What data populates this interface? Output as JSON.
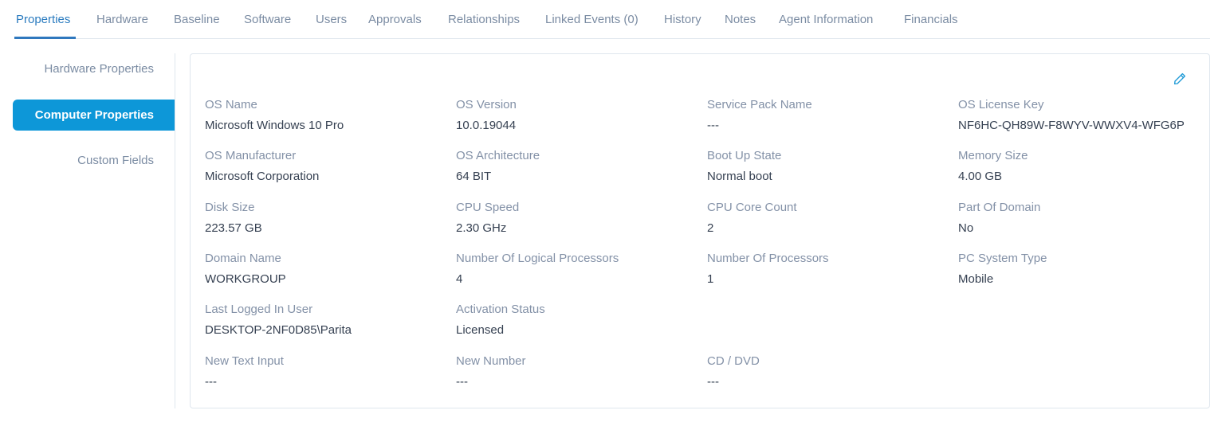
{
  "tabs": [
    {
      "label": "Properties",
      "active": true
    },
    {
      "label": "Hardware"
    },
    {
      "label": "Baseline"
    },
    {
      "label": "Software"
    },
    {
      "label": "Users"
    },
    {
      "label": "Approvals"
    },
    {
      "label": "Relationships"
    },
    {
      "label": "Linked Events (0)"
    },
    {
      "label": "History"
    },
    {
      "label": "Notes"
    },
    {
      "label": "Agent Information"
    },
    {
      "label": "Financials"
    }
  ],
  "side_nav": {
    "items": [
      {
        "label": "Hardware Properties"
      },
      {
        "label": "Computer Properties",
        "active": true
      },
      {
        "label": "Custom Fields"
      }
    ]
  },
  "card": {
    "edit_icon": "pencil-icon",
    "fields": [
      {
        "label": "OS Name",
        "value": "Microsoft Windows 10 Pro"
      },
      {
        "label": "OS Version",
        "value": "10.0.19044"
      },
      {
        "label": "Service Pack Name",
        "value": "---"
      },
      {
        "label": "OS License Key",
        "value": "NF6HC-QH89W-F8WYV-WWXV4-WFG6P"
      },
      {
        "label": "OS Manufacturer",
        "value": "Microsoft Corporation"
      },
      {
        "label": "OS Architecture",
        "value": "64 BIT"
      },
      {
        "label": "Boot Up State",
        "value": "Normal boot"
      },
      {
        "label": "Memory Size",
        "value": "4.00 GB"
      },
      {
        "label": "Disk Size",
        "value": "223.57 GB"
      },
      {
        "label": "CPU Speed",
        "value": "2.30 GHz"
      },
      {
        "label": "CPU Core Count",
        "value": "2"
      },
      {
        "label": "Part Of Domain",
        "value": "No"
      },
      {
        "label": "Domain Name",
        "value": "WORKGROUP"
      },
      {
        "label": "Number Of Logical Processors",
        "value": "4"
      },
      {
        "label": "Number Of Processors",
        "value": "1"
      },
      {
        "label": "PC System Type",
        "value": "Mobile"
      },
      {
        "label": "Last Logged In User",
        "value": "DESKTOP-2NF0D85\\Parita"
      },
      {
        "label": "Activation Status",
        "value": "Licensed"
      },
      {
        "label": "New Text Input",
        "value": "---"
      },
      {
        "label": "New Number",
        "value": "---"
      },
      {
        "label": "CD / DVD",
        "value": "---"
      }
    ]
  },
  "colors": {
    "accent": "#2a7bbf",
    "active_nav_bg": "#0d97d8",
    "label": "#8391a7",
    "value": "#364152"
  }
}
